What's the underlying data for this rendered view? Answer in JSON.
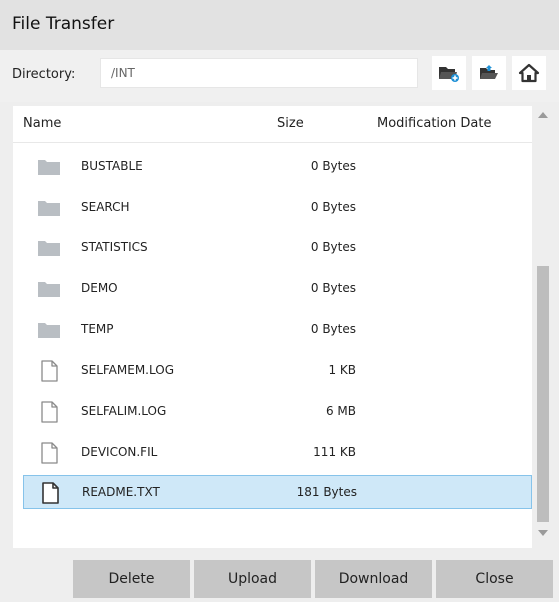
{
  "window": {
    "title": "File Transfer"
  },
  "directory": {
    "label": "Directory:",
    "value": "/INT"
  },
  "toolbar": {
    "icons": [
      "new-folder-icon",
      "open-folder-icon",
      "home-icon"
    ]
  },
  "table": {
    "columns": [
      "Name",
      "Size",
      "Modification Date"
    ],
    "rows": [
      {
        "name": "BUSTABLE",
        "size": "0 Bytes",
        "type": "folder"
      },
      {
        "name": "SEARCH",
        "size": "0 Bytes",
        "type": "folder"
      },
      {
        "name": "STATISTICS",
        "size": "0 Bytes",
        "type": "folder"
      },
      {
        "name": "DEMO",
        "size": "0 Bytes",
        "type": "folder"
      },
      {
        "name": "TEMP",
        "size": "0 Bytes",
        "type": "folder"
      },
      {
        "name": "SELFAMEM.LOG",
        "size": "1 KB",
        "type": "file"
      },
      {
        "name": "SELFALIM.LOG",
        "size": "6 MB",
        "type": "file"
      },
      {
        "name": "DEVICON.FIL",
        "size": "111 KB",
        "type": "file"
      },
      {
        "name": "README.TXT",
        "size": "181 Bytes",
        "type": "file",
        "selected": true
      }
    ]
  },
  "buttons": {
    "delete": "Delete",
    "upload": "Upload",
    "download": "Download",
    "close": "Close"
  },
  "colors": {
    "selection_fill": "#cfe8f8",
    "selection_border": "#86c3ea",
    "accent_blue": "#1e90d6",
    "icon_dark": "#333333",
    "folder_gray": "#b9bec3"
  }
}
